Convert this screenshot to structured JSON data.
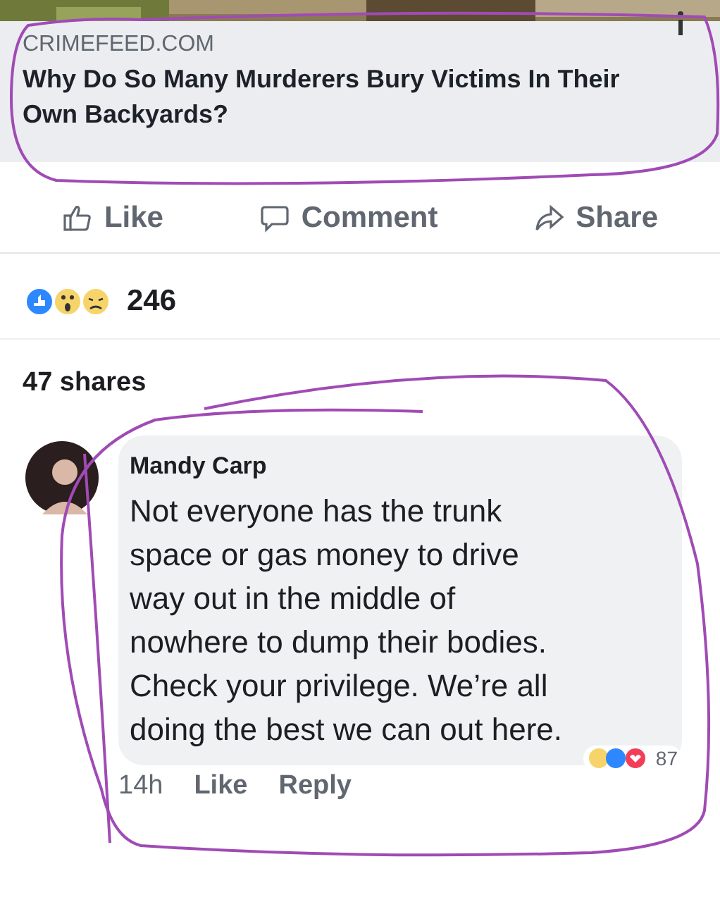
{
  "link_preview": {
    "kind": "picture",
    "domain": "CRIMEFEED.COM",
    "title": "Why Do So Many Murderers Bury Victims In Their Own Backyards?"
  },
  "actions": [
    {
      "kind": "like",
      "label": "Like"
    },
    {
      "kind": "comment",
      "label": "Comment"
    },
    {
      "kind": "share",
      "label": "Share"
    }
  ],
  "reactions": {
    "count": "246"
  },
  "shares": "47 shares",
  "comment": {
    "author": "Mandy Carp",
    "text": "Not everyone has the trunk space or gas money to drive way out in the middle of nowhere to dump their bodies. Check your privilege. We’re all doing the best we can out here.",
    "time": "14h",
    "actions": [
      "Like",
      "Reply"
    ],
    "reaction_count": "87"
  }
}
